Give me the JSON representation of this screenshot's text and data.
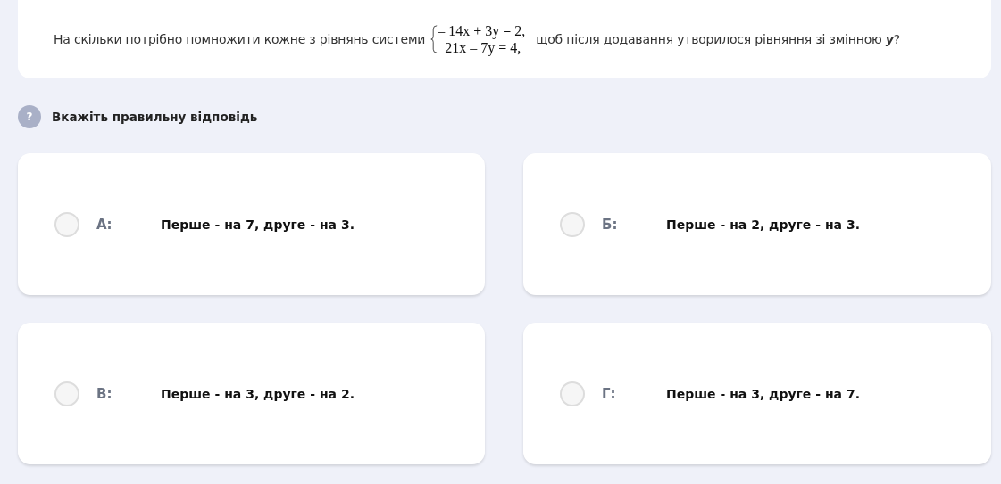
{
  "question": {
    "text_before": "На скільки потрібно помножити кожне з рівнянь системи",
    "system": [
      "– 14x + 3y = 2,",
      "21x – 7y = 4,"
    ],
    "text_after": "щоб після додавання утворилося рівняння зі змінною **y**?"
  },
  "instruction": {
    "icon": "?",
    "text": "Вкажіть правильну відповідь"
  },
  "options": [
    {
      "letter": "А:",
      "text": "Перше - на 7, друге - на 3.",
      "selected": false
    },
    {
      "letter": "Б:",
      "text": "Перше - на 2, друге - на 3.",
      "selected": false
    },
    {
      "letter": "В:",
      "text": "Перше - на 3, друге - на 2.",
      "selected": false
    },
    {
      "letter": "Г:",
      "text": "Перше - на 3, друге - на 7.",
      "selected": false
    }
  ]
}
